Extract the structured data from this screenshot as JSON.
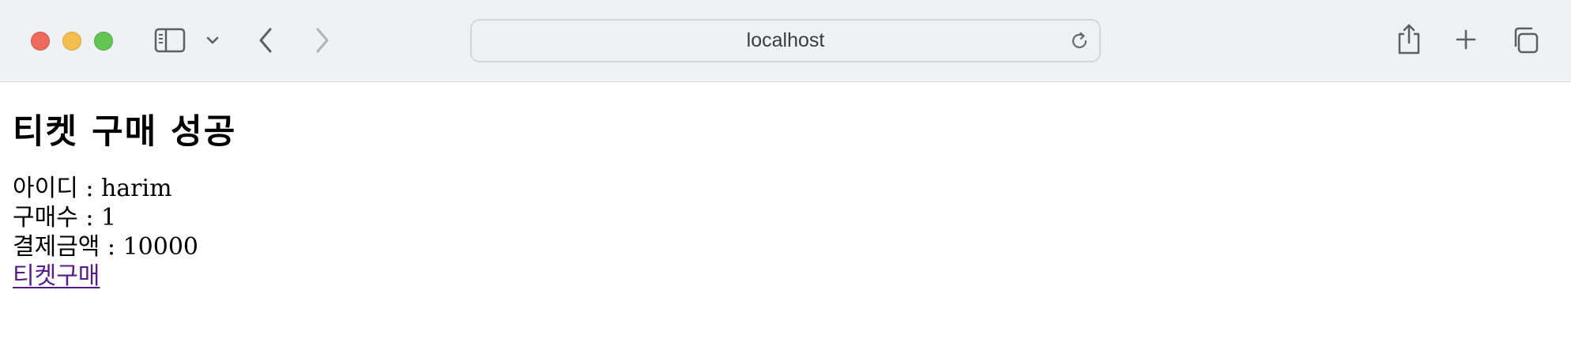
{
  "browser": {
    "address": "localhost"
  },
  "page": {
    "title": "티켓 구매 성공",
    "rows": [
      {
        "text": "아이디 : harim"
      },
      {
        "text": "구매수 : 1"
      },
      {
        "text": "결제금액 : 10000"
      }
    ],
    "link_label": "티켓구매"
  },
  "colors": {
    "visited_link": "#551a8b",
    "toolbar_bg": "#f0f1f3"
  },
  "icons": [
    "sidebar-icon",
    "chevron-down-icon",
    "back-arrow-icon",
    "forward-arrow-icon",
    "reload-icon",
    "share-icon",
    "plus-icon",
    "tabs-icon"
  ]
}
